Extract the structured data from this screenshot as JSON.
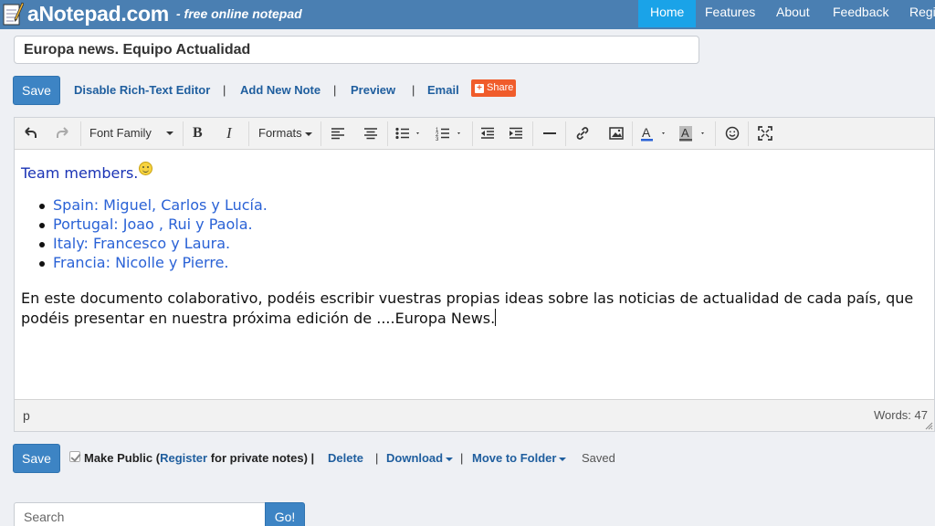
{
  "header": {
    "logo": "aNotepad.com",
    "tagline": "- free online notepad",
    "nav": [
      "Home",
      "Features",
      "About",
      "Feedback",
      "Regi"
    ]
  },
  "note": {
    "title": "Europa news. Equipo Actualidad"
  },
  "actions": {
    "save": "Save",
    "disable_rte": "Disable Rich-Text Editor",
    "add_note": "Add New Note",
    "preview": "Preview",
    "email": "Email",
    "share": "Share",
    "separator": "|"
  },
  "toolbar": {
    "font_family": "Font Family",
    "formats": "Formats"
  },
  "content": {
    "heading": "Team members.",
    "countries": [
      "Spain: Miguel, Carlos y Lucía.",
      "Portugal: Joao , Rui y Paola.",
      "Italy: Francesco y Laura.",
      "Francia: Nicolle y Pierre."
    ],
    "paragraph": "En este documento colaborativo, podéis escribir vuestras propias ideas sobre las noticias de actualidad de cada país, que podéis presentar en nuestra próxima edición de ....Europa News."
  },
  "statusbar": {
    "path": "p",
    "words": "Words: 47"
  },
  "footer": {
    "save": "Save",
    "make_public": "Make Public (",
    "register": "Register",
    "private_notes": " for private notes) |",
    "delete": "Delete",
    "download": "Download",
    "move_to_folder": "Move to Folder",
    "saved": "Saved",
    "search_placeholder": "Search",
    "go": "Go!"
  },
  "colors": {
    "navbar": "#4a7fb2",
    "nav_active": "#1aa3e8",
    "primary_button": "#3d84c4",
    "link": "#1f5e9e",
    "share": "#f05c2b"
  },
  "icons": [
    "undo-icon",
    "redo-icon",
    "bold-icon",
    "italic-icon",
    "align-left-icon",
    "align-center-icon",
    "bullet-list-icon",
    "numbered-list-icon",
    "outdent-icon",
    "indent-icon",
    "horizontal-rule-icon",
    "link-icon",
    "image-icon",
    "text-color-icon",
    "background-color-icon",
    "emoticon-icon",
    "fullscreen-icon"
  ]
}
